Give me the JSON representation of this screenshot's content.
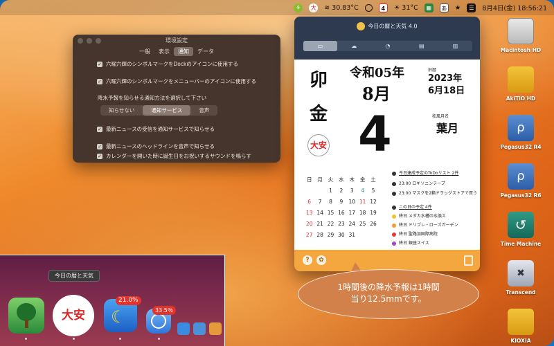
{
  "menubar": {
    "temp_device": "30.83°C",
    "calendar_day": "4",
    "weather_temp": "31°C",
    "datetime": "8月4日(金)  18:56:21"
  },
  "settings": {
    "title": "環境設定",
    "tabs": [
      "一般",
      "表示",
      "通知",
      "データ"
    ],
    "active_tab": "通知",
    "options": [
      "六曜六輝のシンボルマークをDockのアイコンに使用する",
      "六曜六輝のシンボルマークをメニューバーのアイコンに使用する",
      "最新ニュースの受信を通知サービスで知らせる",
      "最新ニュースのヘッドラインを音声で知らせる",
      "カレンダーを開いた時に誕生日をお祝いするサウンドを鳴らす"
    ],
    "rain_label": "降水予報を知らせる通知方法を選択して下さい",
    "rain_choices": [
      "知らせない",
      "通知サービス",
      "音声"
    ],
    "rain_selected": "通知サービス"
  },
  "widget": {
    "title": "今日の暦と天気 4.0",
    "kanji_top": "卯",
    "kanji_bottom": "金",
    "rokuyo": "大安",
    "era_year": "令和05年",
    "month": "8月",
    "day": "4",
    "old_calendar_label": "旧暦",
    "old_year": "2023年",
    "old_date": "6月18日",
    "wamei_label": "和風月名",
    "wamei": "葉月",
    "weekdays": [
      "日",
      "月",
      "火",
      "水",
      "木",
      "金",
      "土"
    ],
    "weeks": [
      [
        "",
        "",
        "1",
        "2",
        "3",
        "4",
        "5"
      ],
      [
        "6",
        "7",
        "8",
        "9",
        "10",
        "11",
        "12"
      ],
      [
        "13",
        "14",
        "15",
        "16",
        "17",
        "18",
        "19"
      ],
      [
        "20",
        "21",
        "22",
        "23",
        "24",
        "25",
        "26"
      ],
      [
        "27",
        "28",
        "29",
        "30",
        "31",
        "",
        ""
      ]
    ],
    "todo_header": "今日達成予定のToDoリスト 2件",
    "todos": [
      "23:00 ロキソニンテープ",
      "23:00 マスクを2箱ドラッグストアで買う"
    ],
    "event_header": "この日の予定 4件",
    "events": [
      {
        "text": "終日 メダカ水槽の水換え",
        "color": "#f2c230"
      },
      {
        "text": "終日 ドリブレ・ローズガーデン",
        "color": "#f29b30"
      },
      {
        "text": "終日 聖路加国際病院",
        "color": "#e33b3b"
      },
      {
        "text": "終日 銀座スイス",
        "color": "#a346c7"
      }
    ],
    "foot_help": "?",
    "foot_gear": "✿"
  },
  "bubble": {
    "line1": "1時間後の降水予報は1時間",
    "line2": "当り12.5mmです。"
  },
  "dock": {
    "tooltip": "今日の暦と天気",
    "rokuyo_label": "大安",
    "badge_1": "21.0%",
    "badge_2": "33.5％"
  },
  "desktop": [
    {
      "label": "Macintosh HD"
    },
    {
      "label": "AkiTiO HD"
    },
    {
      "label": "Pegasus32 R4"
    },
    {
      "label": "Pegasus32 R6"
    },
    {
      "label": "Time Machine"
    },
    {
      "label": "Transcend"
    },
    {
      "label": "KIOXIA"
    }
  ]
}
